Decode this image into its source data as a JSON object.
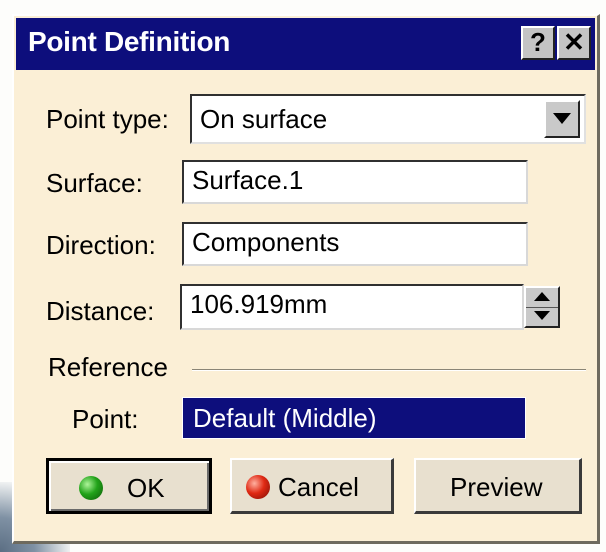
{
  "window": {
    "title": "Point Definition",
    "help_label": "?",
    "close_label": "✕"
  },
  "form": {
    "point_type": {
      "label": "Point type:",
      "value": "On surface"
    },
    "surface": {
      "label": "Surface:",
      "value": "Surface.1"
    },
    "direction": {
      "label": "Direction:",
      "value": "Components"
    },
    "distance": {
      "label": "Distance:",
      "value": "106.919mm"
    },
    "reference": {
      "group_label": "Reference",
      "point_label": "Point:",
      "point_value": "Default (Middle)"
    }
  },
  "buttons": {
    "ok": "OK",
    "cancel": "Cancel",
    "preview": "Preview"
  },
  "icons": {
    "ok": "green-ball-icon",
    "cancel": "red-ball-icon",
    "dropdown": "triangle-down-icon",
    "spinner": "up-down-spinner-icon"
  },
  "colors": {
    "titlebar": "#0d0e7c",
    "dialog_bg": "#fbefd6",
    "selected_field": "#0d0e7c"
  }
}
